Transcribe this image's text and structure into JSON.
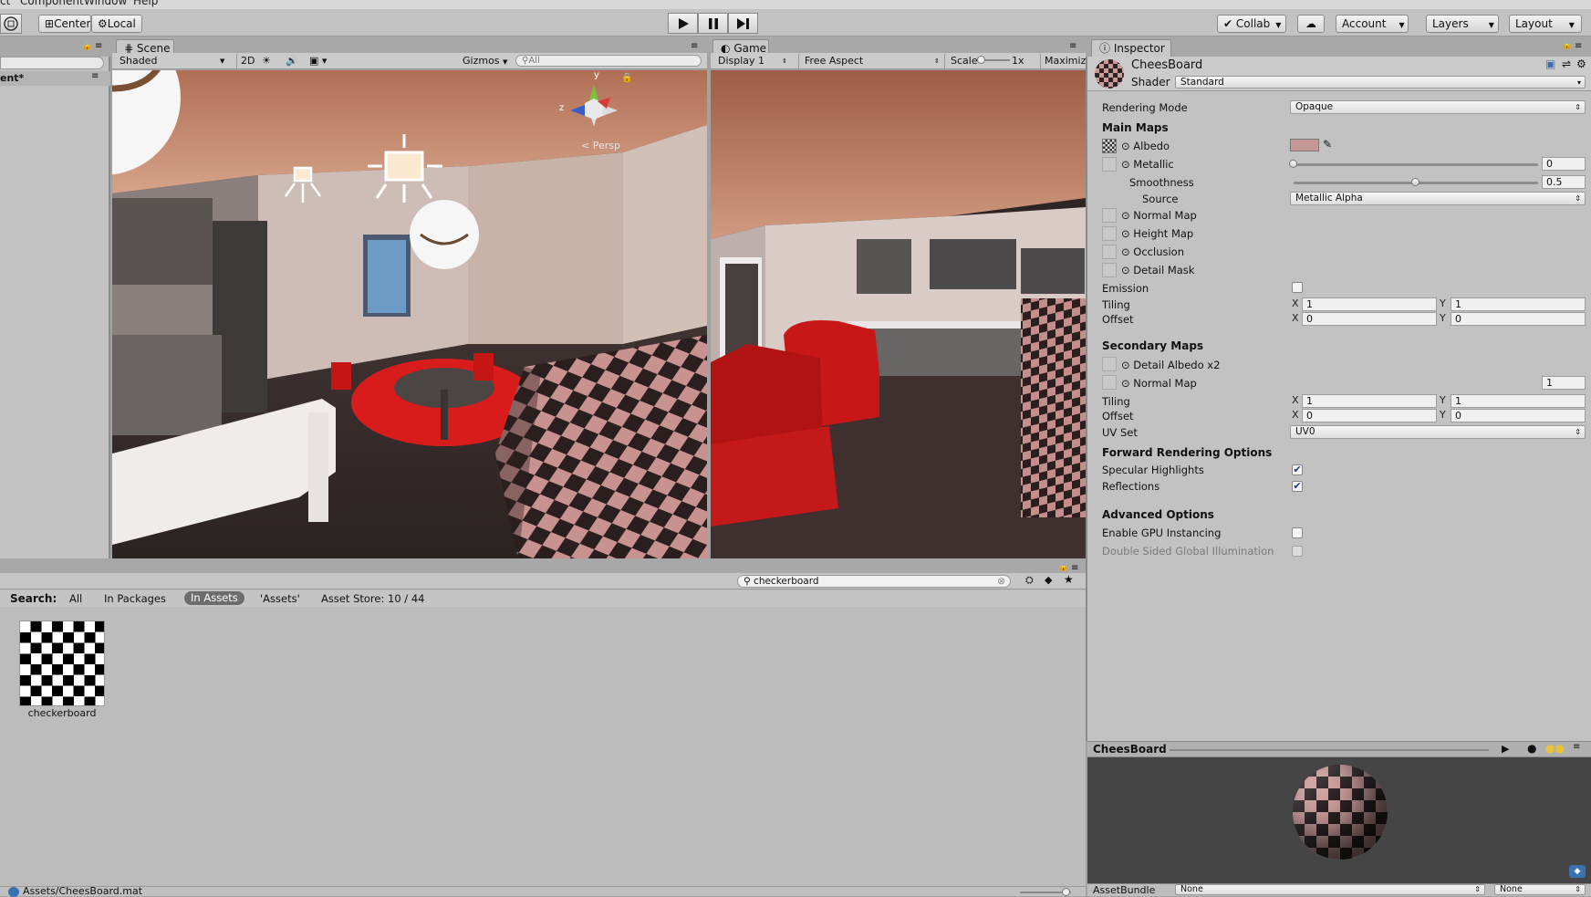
{
  "menu": {
    "items": [
      "ct",
      "Component",
      "Window",
      "Help"
    ]
  },
  "toolbar": {
    "center_label": "Center",
    "local_label": "Local",
    "collab_label": "Collab",
    "account_label": "Account",
    "layers_label": "Layers",
    "layout_label": "Layout"
  },
  "hierarchy": {
    "scene_label": "ent*"
  },
  "scene": {
    "tab_label": "Scene",
    "shading_mode": "Shaded",
    "mode_2d": "2D",
    "gizmos_label": "Gizmos",
    "search_placeholder": "All",
    "persp_label": "Persp",
    "axis_y": "y",
    "axis_z": "z"
  },
  "game": {
    "tab_label": "Game",
    "display": "Display 1",
    "aspect": "Free Aspect",
    "scale_label": "Scale",
    "scale_value": "1x",
    "maximize_label": "Maximize"
  },
  "project": {
    "search_value": "checkerboard",
    "search_label": "Search:",
    "filters": [
      "All",
      "In Packages",
      "In Assets",
      "'Assets'",
      "Asset Store: 10 / 44"
    ],
    "active_filter": "In Assets",
    "assets": [
      {
        "name": "checkerboard"
      }
    ],
    "path": "Assets/CheesBoard.mat"
  },
  "inspector": {
    "tab_label": "Inspector",
    "material_name": "CheesBoard",
    "shader_label": "Shader",
    "shader_value": "Standard",
    "rendering_mode_label": "Rendering Mode",
    "rendering_mode_value": "Opaque",
    "main_maps_header": "Main Maps",
    "albedo_label": "Albedo",
    "albedo_color": "#c59897",
    "metallic_label": "Metallic",
    "metallic_value": "0",
    "smoothness_label": "Smoothness",
    "smoothness_value": "0.5",
    "source_label": "Source",
    "source_value": "Metallic Alpha",
    "normal_map_label": "Normal Map",
    "height_map_label": "Height Map",
    "occlusion_label": "Occlusion",
    "detail_mask_label": "Detail Mask",
    "emission_label": "Emission",
    "emission_checked": false,
    "tiling_label": "Tiling",
    "offset_label": "Offset",
    "axis_x": "X",
    "axis_y": "Y",
    "main_tiling_x": "1",
    "main_tiling_y": "1",
    "main_offset_x": "0",
    "main_offset_y": "0",
    "secondary_maps_header": "Secondary Maps",
    "detail_albedo_label": "Detail Albedo x2",
    "secondary_normal_label": "Normal Map",
    "secondary_normal_scale": "1",
    "sec_tiling_x": "1",
    "sec_tiling_y": "1",
    "sec_offset_x": "0",
    "sec_offset_y": "0",
    "uv_set_label": "UV Set",
    "uv_set_value": "UV0",
    "forward_header": "Forward Rendering Options",
    "specular_label": "Specular Highlights",
    "specular_checked": true,
    "reflections_label": "Reflections",
    "reflections_checked": true,
    "advanced_header": "Advanced Options",
    "gpu_instancing_label": "Enable GPU Instancing",
    "gpu_instancing_checked": false,
    "double_sided_gi_label": "Double Sided Global Illumination",
    "double_sided_gi_checked": false
  },
  "preview": {
    "title": "CheesBoard",
    "assetbundle_label": "AssetBundle",
    "assetbundle_value": "None",
    "variant_value": "None"
  },
  "sliders": {
    "metallic": 0,
    "smoothness": 0.5
  },
  "colors": {
    "accent": "#3a72b0",
    "floor_rug": "#d01818",
    "wall": "#c8b4ac",
    "ceiling": "#c08268"
  }
}
